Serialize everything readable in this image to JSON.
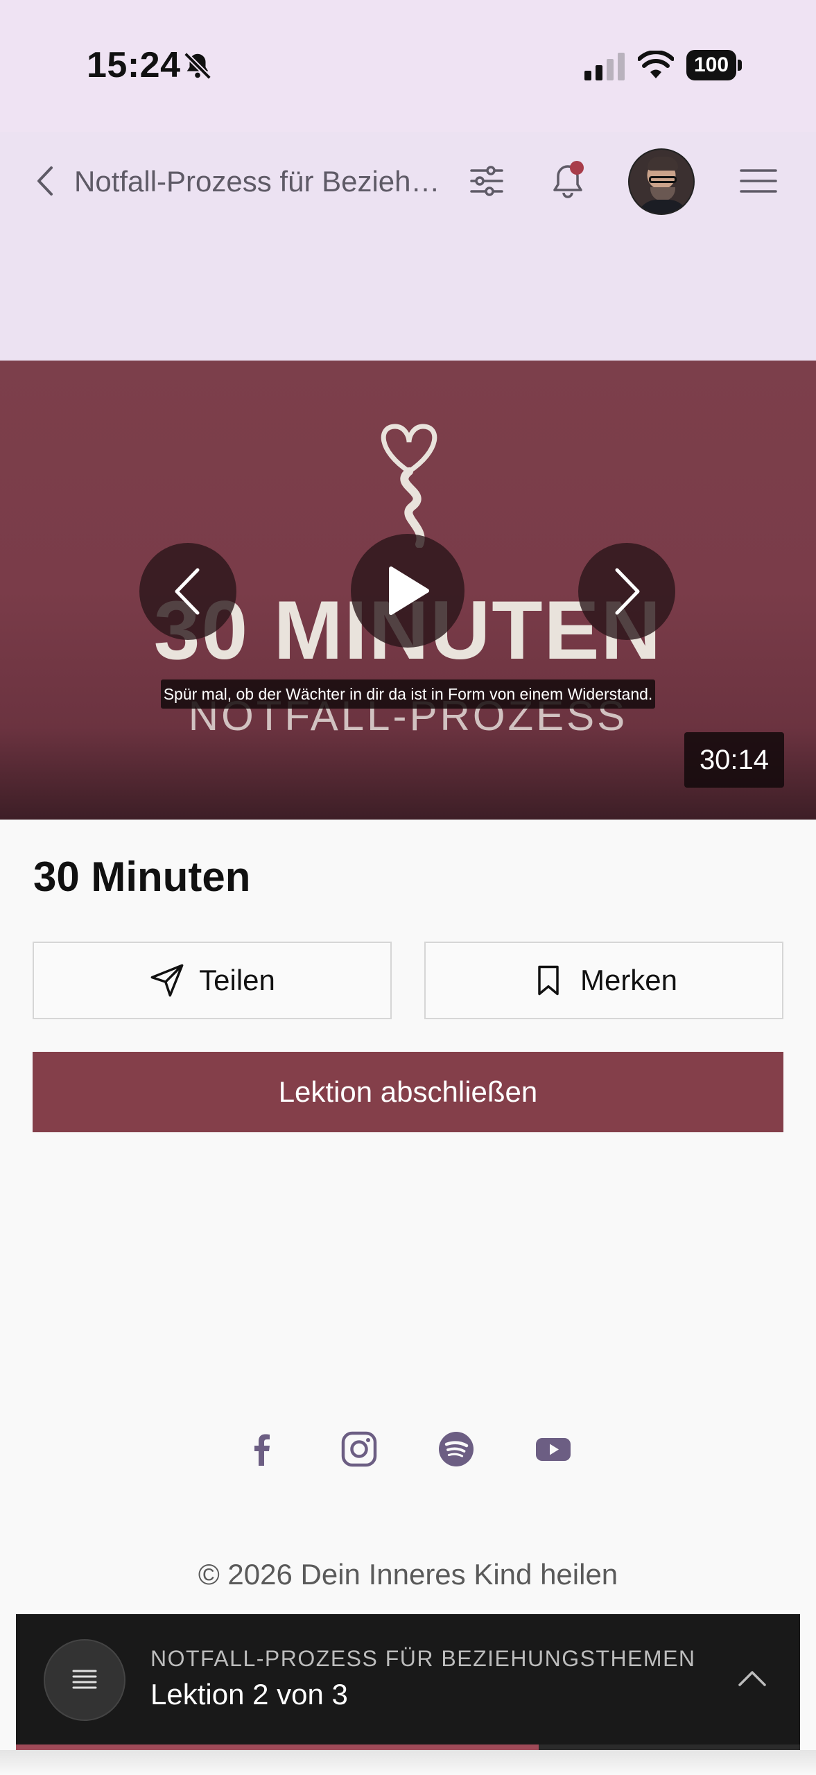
{
  "status_bar": {
    "time": "15:24",
    "battery": "100"
  },
  "nav": {
    "title": "Notfall-Prozess für Beziehungsthemen"
  },
  "video": {
    "overlay_title": "30 MINUTEN",
    "overlay_subtitle": "NOTFALL-PROZESS",
    "caption": "Spür mal, ob der Wächter in dir da ist in Form von einem Widerstand.",
    "duration": "30:14"
  },
  "lesson": {
    "title": "30 Minuten",
    "share_label": "Teilen",
    "save_label": "Merken",
    "complete_label": "Lektion abschließen"
  },
  "footer": {
    "socials": [
      "facebook-icon",
      "instagram-icon",
      "spotify-icon",
      "youtube-icon"
    ],
    "copyright": "© 2026 Dein Inneres Kind heilen"
  },
  "course_bar": {
    "course_name": "NOTFALL-PROZESS FÜR BEZIEHUNGSTHEMEN",
    "lesson_progress": "Lektion 2 von 3",
    "progress_fraction": 0.667
  },
  "colors": {
    "accent": "#843f4a",
    "header_bg": "#ece2f2",
    "notification_dot": "#a83c4a"
  }
}
